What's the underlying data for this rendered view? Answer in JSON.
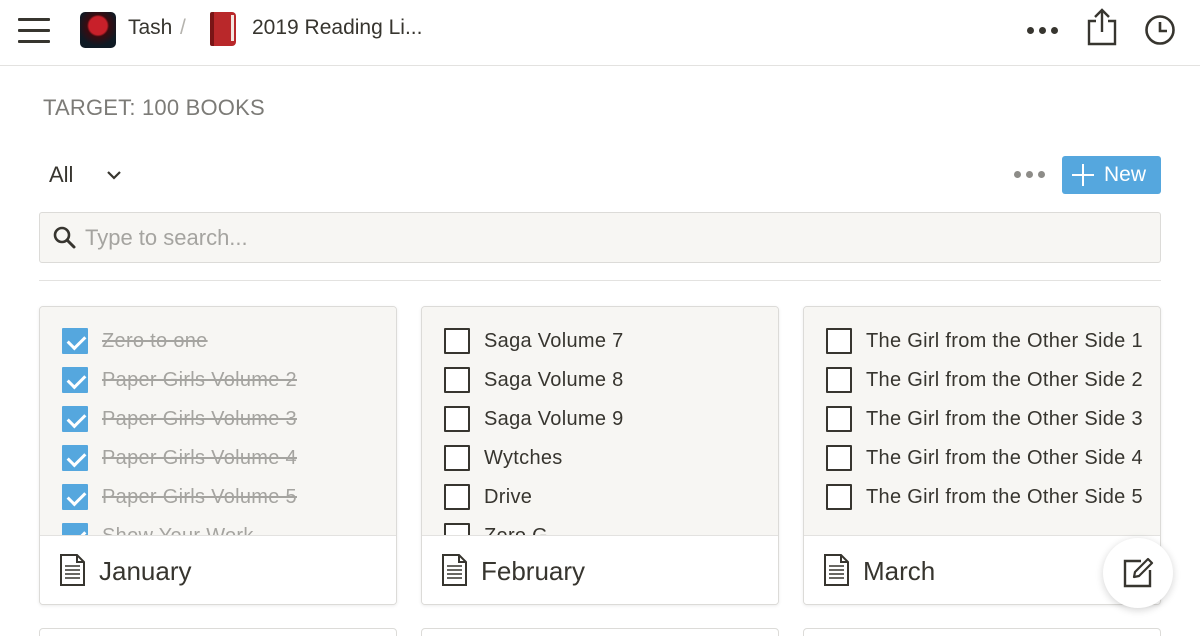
{
  "topbar": {
    "workspace": "Tash",
    "separator": "/",
    "page": "2019 Reading Li...",
    "icons": [
      "menu-icon",
      "workspace-avatar-icon",
      "book-icon",
      "more-icon",
      "share-icon",
      "history-clock-icon"
    ]
  },
  "target_heading": "TARGET: 100 BOOKS",
  "view": {
    "label": "All",
    "new_button": "New"
  },
  "search": {
    "placeholder": "Type to search..."
  },
  "colors": {
    "accent": "#55a7de",
    "text": "#37352f",
    "muted": "#a5a4a0",
    "card_bg": "#f7f6f3"
  },
  "cards": [
    {
      "title": "January",
      "items": [
        {
          "label": "Zero to one",
          "checked": true
        },
        {
          "label": "Paper Girls Volume 2",
          "checked": true
        },
        {
          "label": "Paper Girls Volume 3",
          "checked": true
        },
        {
          "label": "Paper Girls Volume 4",
          "checked": true
        },
        {
          "label": "Paper Girls Volume 5",
          "checked": true
        },
        {
          "label": "Show Your Work",
          "checked": true
        }
      ]
    },
    {
      "title": "February",
      "items": [
        {
          "label": "Saga Volume 7",
          "checked": false
        },
        {
          "label": "Saga Volume 8",
          "checked": false
        },
        {
          "label": "Saga Volume 9",
          "checked": false
        },
        {
          "label": "Wytches",
          "checked": false
        },
        {
          "label": "Drive",
          "checked": false
        },
        {
          "label": "Zero G",
          "checked": false
        }
      ]
    },
    {
      "title": "March",
      "items": [
        {
          "label": "The Girl from the Other Side 1",
          "checked": false
        },
        {
          "label": "The Girl from the Other Side 2",
          "checked": false
        },
        {
          "label": "The Girl from the Other Side 3",
          "checked": false
        },
        {
          "label": "The Girl from the Other Side 4",
          "checked": false
        },
        {
          "label": "The Girl from the Other Side 5",
          "checked": false
        }
      ]
    }
  ]
}
